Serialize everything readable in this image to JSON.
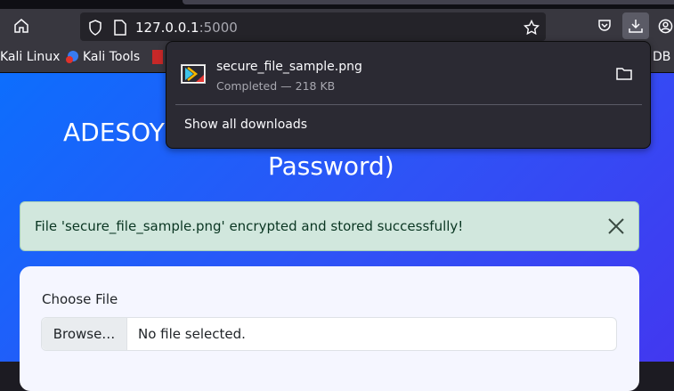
{
  "browser": {
    "url_host": "127.0.0.1",
    "url_port": ":5000",
    "bookmarks": [
      {
        "label": "Kali Linux"
      },
      {
        "label": "Kali Tools"
      },
      {
        "label": "DB"
      }
    ]
  },
  "downloads_panel": {
    "file_name": "secure_file_sample.png",
    "status": "Completed — 218 KB",
    "show_all_label": "Show all downloads"
  },
  "page": {
    "title_part1": "ADESOY",
    "title_part2": "Password)",
    "alert": {
      "message": "File 'secure_file_sample.png' encrypted and stored successfully!",
      "type": "success",
      "color": "#d1e7dd"
    },
    "form": {
      "file_label": "Choose File",
      "browse_label": "Browse…",
      "file_status": "No file selected."
    }
  }
}
